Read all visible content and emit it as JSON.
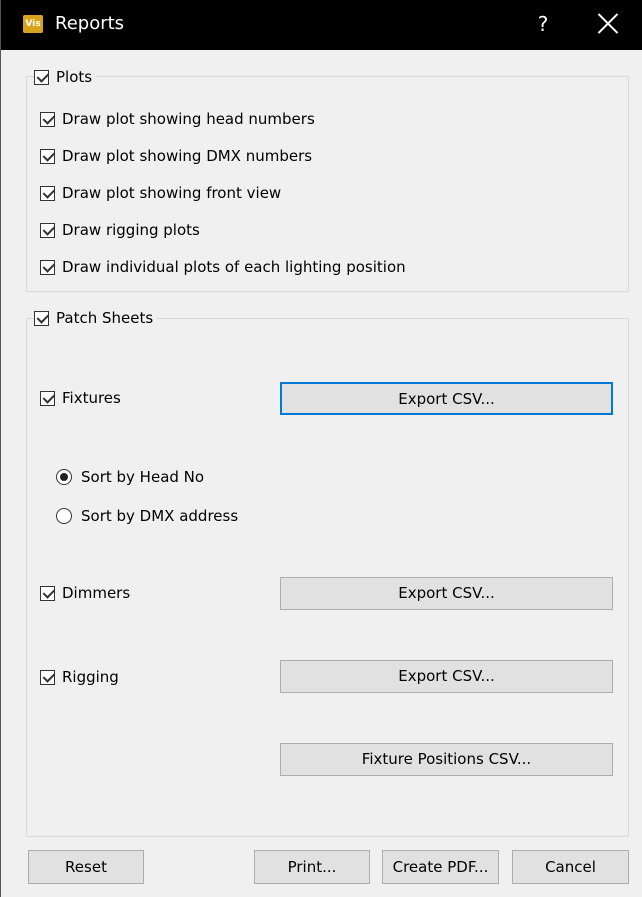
{
  "window": {
    "title": "Reports",
    "app_icon": "Vis",
    "help": "?"
  },
  "plots": {
    "label": "Plots",
    "checked": true,
    "options": [
      {
        "label": "Draw plot showing head numbers",
        "checked": true
      },
      {
        "label": "Draw plot showing DMX numbers",
        "checked": true
      },
      {
        "label": "Draw plot showing front view",
        "checked": true
      },
      {
        "label": "Draw rigging plots",
        "checked": true
      },
      {
        "label": "Draw individual plots of each lighting position",
        "checked": true
      }
    ]
  },
  "patch_sheets": {
    "label": "Patch Sheets",
    "checked": true,
    "fixtures": {
      "label": "Fixtures",
      "checked": true,
      "export_label": "Export CSV..."
    },
    "sort": {
      "options": [
        {
          "label": "Sort by Head No",
          "selected": true
        },
        {
          "label": "Sort by DMX address",
          "selected": false
        }
      ]
    },
    "dimmers": {
      "label": "Dimmers",
      "checked": true,
      "export_label": "Export CSV..."
    },
    "rigging": {
      "label": "Rigging",
      "checked": true,
      "export_label": "Export CSV..."
    },
    "fixture_positions_label": "Fixture Positions CSV..."
  },
  "buttons": {
    "reset": "Reset",
    "print": "Print...",
    "create_pdf": "Create PDF...",
    "cancel": "Cancel"
  },
  "colors": {
    "titlebar": "#000000",
    "focus_border": "#0078d7",
    "button_bg": "#e1e1e1"
  }
}
